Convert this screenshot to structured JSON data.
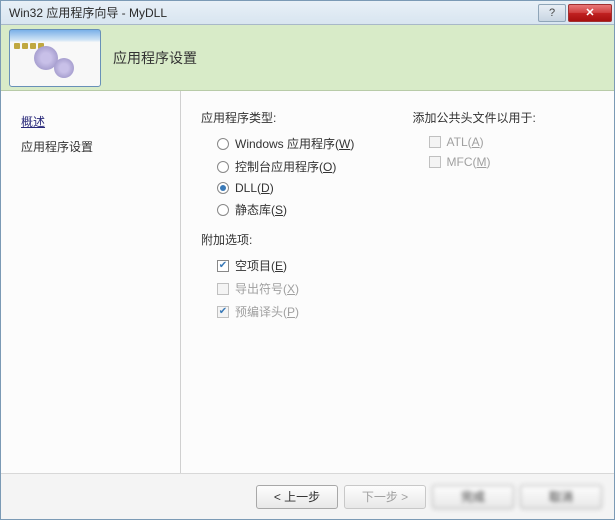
{
  "window_title": "Win32 应用程序向导 - MyDLL",
  "banner_title": "应用程序设置",
  "sidebar": {
    "items": [
      {
        "label": "概述"
      },
      {
        "label": "应用程序设置"
      }
    ]
  },
  "content": {
    "app_type_label": "应用程序类型:",
    "app_type_options": [
      {
        "label": "Windows 应用程序",
        "accel": "W",
        "checked": false
      },
      {
        "label": "控制台应用程序",
        "accel": "O",
        "checked": false
      },
      {
        "label": "DLL",
        "accel": "D",
        "checked": true
      },
      {
        "label": "静态库",
        "accel": "S",
        "checked": false
      }
    ],
    "additional_label": "附加选项:",
    "additional_options": [
      {
        "label": "空项目",
        "accel": "E",
        "checked": true,
        "disabled": false
      },
      {
        "label": "导出符号",
        "accel": "X",
        "checked": false,
        "disabled": true
      },
      {
        "label": "预编译头",
        "accel": "P",
        "checked": true,
        "disabled": true
      }
    ],
    "headers_label": "添加公共头文件以用于:",
    "headers_options": [
      {
        "label": "ATL",
        "accel": "A",
        "checked": false,
        "disabled": true
      },
      {
        "label": "MFC",
        "accel": "M",
        "checked": false,
        "disabled": true
      }
    ]
  },
  "footer": {
    "prev": "< 上一步",
    "next": "下一步 >",
    "finish": "完成",
    "cancel": "取消"
  }
}
